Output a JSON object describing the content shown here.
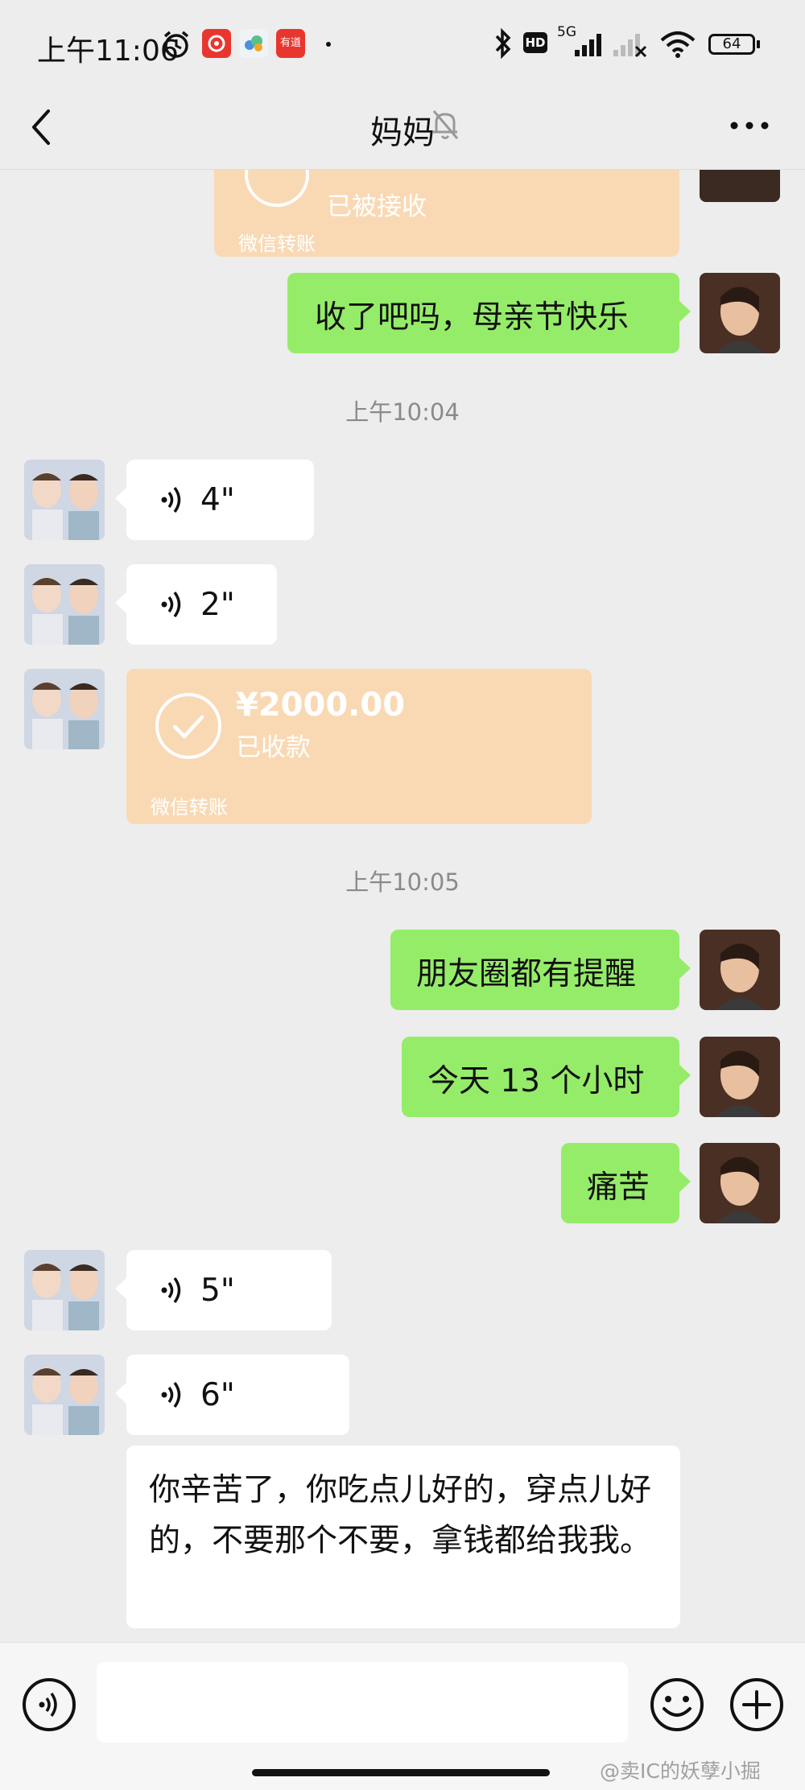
{
  "status_bar": {
    "time": "上午11:06",
    "network": "5G",
    "hd": "HD",
    "battery": "64",
    "app_icon_red_text": "有道"
  },
  "header": {
    "title": "妈妈"
  },
  "messages": {
    "top_transfer": {
      "status": "已被接收",
      "label": "微信转账"
    },
    "m1": {
      "text": "收了吧吗，母亲节快乐"
    },
    "time1": "上午10:04",
    "voice1": {
      "duration": "4\""
    },
    "voice2": {
      "duration": "2\""
    },
    "transfer": {
      "amount": "¥2000.00",
      "status": "已收款",
      "label": "微信转账"
    },
    "time2": "上午10:05",
    "m2": {
      "text": "朋友圈都有提醒"
    },
    "m3": {
      "text": "今天 13 个小时"
    },
    "m4": {
      "text": "痛苦"
    },
    "voice3": {
      "duration": "5\""
    },
    "voice4": {
      "duration": "6\""
    },
    "m5": {
      "text": "你辛苦了，你吃点儿好的，穿点儿好的，不要那个不要，拿钱都给我我。"
    }
  },
  "watermark": "@卖IC的妖孽小掘",
  "colors": {
    "background": "#ededed",
    "sent_bubble": "#95ec69",
    "received_bubble": "#ffffff",
    "transfer": "#f9d9b4"
  }
}
